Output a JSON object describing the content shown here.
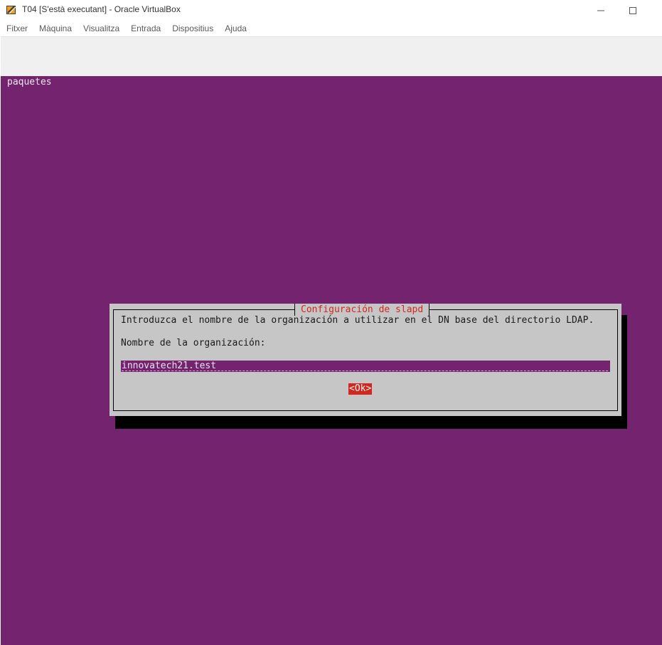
{
  "window": {
    "title": "T04 [S'està executant] - Oracle VirtualBox"
  },
  "menu": {
    "items": [
      "Fitxer",
      "Màquina",
      "Visualitza",
      "Entrada",
      "Dispositius",
      "Ajuda"
    ]
  },
  "vm": {
    "backtitle": "paquetes",
    "dialog": {
      "title": "Configuración de slapd",
      "prompt": "Introduzca el nombre de la organización a utilizar en el DN base del directorio LDAP.",
      "field_label": "Nombre de la organización:",
      "field_value": "innovatech21.test",
      "ok_label": "<Ok>"
    }
  },
  "colors": {
    "vm_background": "#74246e",
    "dialog_background": "#c6c6c6",
    "accent_red": "#d0281e"
  },
  "icons": {
    "app": "virtualbox-icon",
    "minimize": "minimize-icon",
    "maximize": "maximize-icon"
  }
}
